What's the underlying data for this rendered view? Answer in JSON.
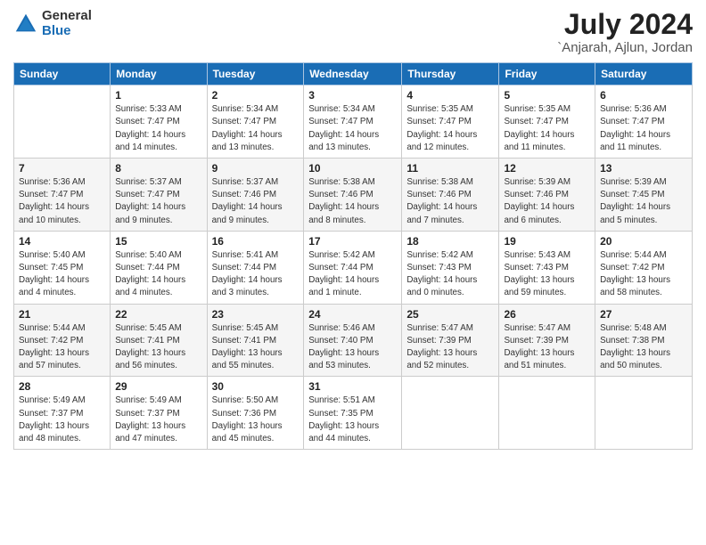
{
  "logo": {
    "general": "General",
    "blue": "Blue"
  },
  "title": "July 2024",
  "subtitle": "`Anjarah, Ajlun, Jordan",
  "headers": [
    "Sunday",
    "Monday",
    "Tuesday",
    "Wednesday",
    "Thursday",
    "Friday",
    "Saturday"
  ],
  "weeks": [
    [
      {
        "day": "",
        "info": ""
      },
      {
        "day": "1",
        "info": "Sunrise: 5:33 AM\nSunset: 7:47 PM\nDaylight: 14 hours\nand 14 minutes."
      },
      {
        "day": "2",
        "info": "Sunrise: 5:34 AM\nSunset: 7:47 PM\nDaylight: 14 hours\nand 13 minutes."
      },
      {
        "day": "3",
        "info": "Sunrise: 5:34 AM\nSunset: 7:47 PM\nDaylight: 14 hours\nand 13 minutes."
      },
      {
        "day": "4",
        "info": "Sunrise: 5:35 AM\nSunset: 7:47 PM\nDaylight: 14 hours\nand 12 minutes."
      },
      {
        "day": "5",
        "info": "Sunrise: 5:35 AM\nSunset: 7:47 PM\nDaylight: 14 hours\nand 11 minutes."
      },
      {
        "day": "6",
        "info": "Sunrise: 5:36 AM\nSunset: 7:47 PM\nDaylight: 14 hours\nand 11 minutes."
      }
    ],
    [
      {
        "day": "7",
        "info": "Sunrise: 5:36 AM\nSunset: 7:47 PM\nDaylight: 14 hours\nand 10 minutes."
      },
      {
        "day": "8",
        "info": "Sunrise: 5:37 AM\nSunset: 7:47 PM\nDaylight: 14 hours\nand 9 minutes."
      },
      {
        "day": "9",
        "info": "Sunrise: 5:37 AM\nSunset: 7:46 PM\nDaylight: 14 hours\nand 9 minutes."
      },
      {
        "day": "10",
        "info": "Sunrise: 5:38 AM\nSunset: 7:46 PM\nDaylight: 14 hours\nand 8 minutes."
      },
      {
        "day": "11",
        "info": "Sunrise: 5:38 AM\nSunset: 7:46 PM\nDaylight: 14 hours\nand 7 minutes."
      },
      {
        "day": "12",
        "info": "Sunrise: 5:39 AM\nSunset: 7:46 PM\nDaylight: 14 hours\nand 6 minutes."
      },
      {
        "day": "13",
        "info": "Sunrise: 5:39 AM\nSunset: 7:45 PM\nDaylight: 14 hours\nand 5 minutes."
      }
    ],
    [
      {
        "day": "14",
        "info": "Sunrise: 5:40 AM\nSunset: 7:45 PM\nDaylight: 14 hours\nand 4 minutes."
      },
      {
        "day": "15",
        "info": "Sunrise: 5:40 AM\nSunset: 7:44 PM\nDaylight: 14 hours\nand 4 minutes."
      },
      {
        "day": "16",
        "info": "Sunrise: 5:41 AM\nSunset: 7:44 PM\nDaylight: 14 hours\nand 3 minutes."
      },
      {
        "day": "17",
        "info": "Sunrise: 5:42 AM\nSunset: 7:44 PM\nDaylight: 14 hours\nand 1 minute."
      },
      {
        "day": "18",
        "info": "Sunrise: 5:42 AM\nSunset: 7:43 PM\nDaylight: 14 hours\nand 0 minutes."
      },
      {
        "day": "19",
        "info": "Sunrise: 5:43 AM\nSunset: 7:43 PM\nDaylight: 13 hours\nand 59 minutes."
      },
      {
        "day": "20",
        "info": "Sunrise: 5:44 AM\nSunset: 7:42 PM\nDaylight: 13 hours\nand 58 minutes."
      }
    ],
    [
      {
        "day": "21",
        "info": "Sunrise: 5:44 AM\nSunset: 7:42 PM\nDaylight: 13 hours\nand 57 minutes."
      },
      {
        "day": "22",
        "info": "Sunrise: 5:45 AM\nSunset: 7:41 PM\nDaylight: 13 hours\nand 56 minutes."
      },
      {
        "day": "23",
        "info": "Sunrise: 5:45 AM\nSunset: 7:41 PM\nDaylight: 13 hours\nand 55 minutes."
      },
      {
        "day": "24",
        "info": "Sunrise: 5:46 AM\nSunset: 7:40 PM\nDaylight: 13 hours\nand 53 minutes."
      },
      {
        "day": "25",
        "info": "Sunrise: 5:47 AM\nSunset: 7:39 PM\nDaylight: 13 hours\nand 52 minutes."
      },
      {
        "day": "26",
        "info": "Sunrise: 5:47 AM\nSunset: 7:39 PM\nDaylight: 13 hours\nand 51 minutes."
      },
      {
        "day": "27",
        "info": "Sunrise: 5:48 AM\nSunset: 7:38 PM\nDaylight: 13 hours\nand 50 minutes."
      }
    ],
    [
      {
        "day": "28",
        "info": "Sunrise: 5:49 AM\nSunset: 7:37 PM\nDaylight: 13 hours\nand 48 minutes."
      },
      {
        "day": "29",
        "info": "Sunrise: 5:49 AM\nSunset: 7:37 PM\nDaylight: 13 hours\nand 47 minutes."
      },
      {
        "day": "30",
        "info": "Sunrise: 5:50 AM\nSunset: 7:36 PM\nDaylight: 13 hours\nand 45 minutes."
      },
      {
        "day": "31",
        "info": "Sunrise: 5:51 AM\nSunset: 7:35 PM\nDaylight: 13 hours\nand 44 minutes."
      },
      {
        "day": "",
        "info": ""
      },
      {
        "day": "",
        "info": ""
      },
      {
        "day": "",
        "info": ""
      }
    ]
  ]
}
